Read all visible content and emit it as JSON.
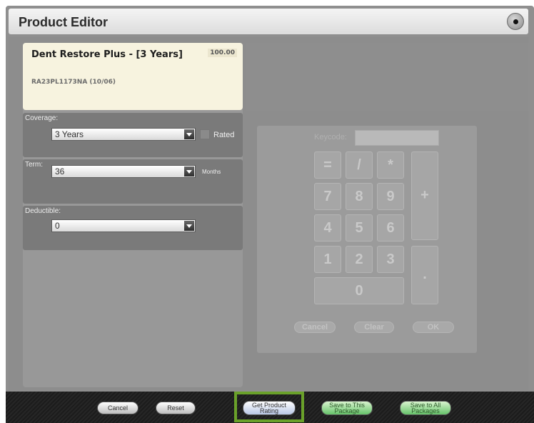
{
  "window": {
    "title": "Product Editor"
  },
  "product": {
    "name": "Dent Restore Plus - [3 Years]",
    "price": "100.00",
    "code": "RA23PL1173NA (10/06)"
  },
  "coverage": {
    "label": "Coverage:",
    "value": "3 Years",
    "rated_label": "Rated"
  },
  "term": {
    "label": "Term:",
    "value": "36",
    "unit": "Months"
  },
  "deductible": {
    "label": "Deductible:",
    "value": "0"
  },
  "keypad": {
    "keycode_label": "Keycode:",
    "keys": [
      "=",
      "/",
      "*",
      "+",
      "7",
      "8",
      "9",
      "4",
      "5",
      "6",
      "1",
      "2",
      "3",
      "0",
      "."
    ],
    "cancel": "Cancel",
    "clear": "Clear",
    "ok": "OK"
  },
  "footer": {
    "cancel": "Cancel",
    "reset": "Reset",
    "get_rating_line1": "Get Product",
    "get_rating_line2": "Rating",
    "save_package_line1": "Save to This",
    "save_package_line2": "Package",
    "save_all_line1": "Save to All",
    "save_all_line2": "Packages"
  },
  "colors": {
    "highlight": "#6aa12a",
    "card": "#f7f3df",
    "panel": "#8d8d8d"
  },
  "icons": {
    "close": "close-icon"
  }
}
